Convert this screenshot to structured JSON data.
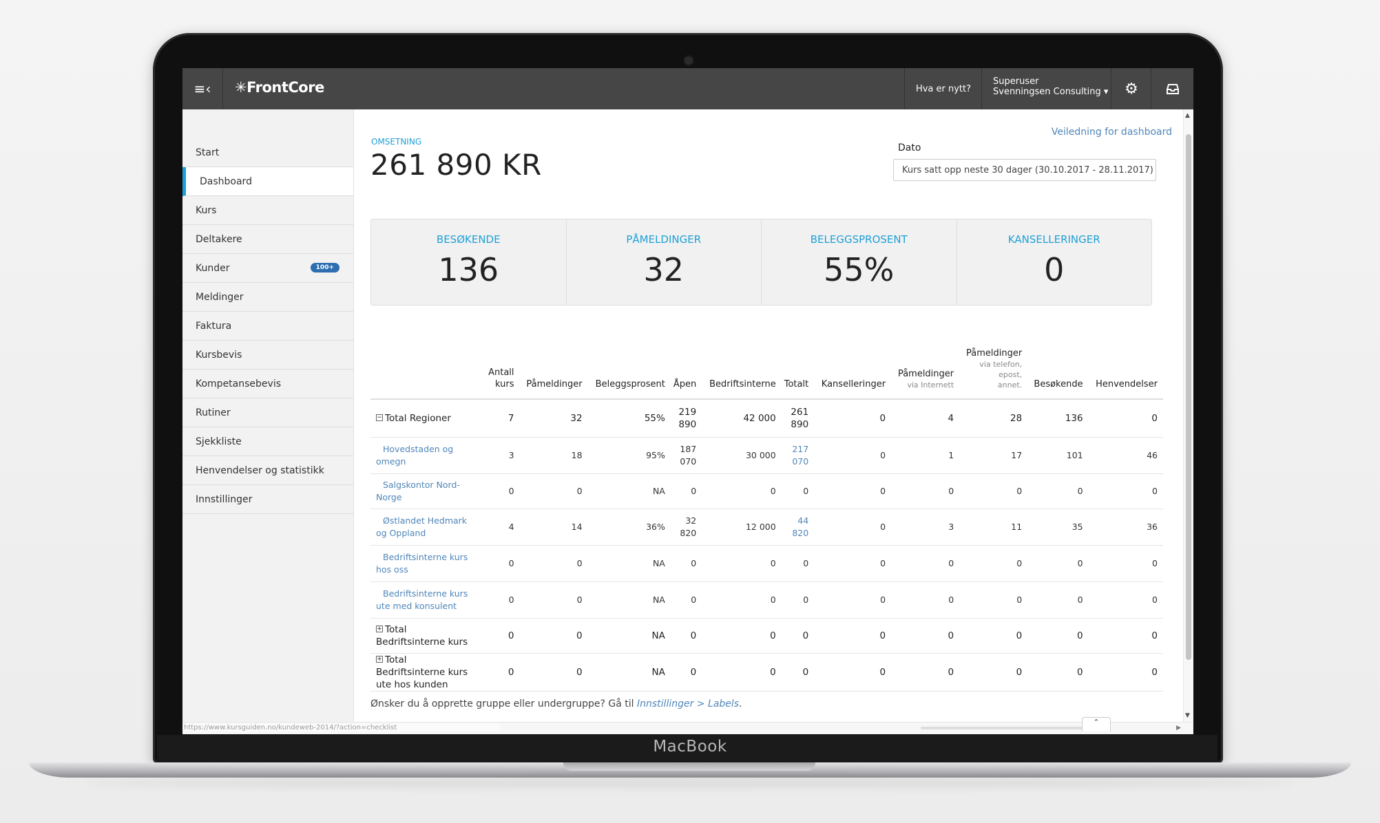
{
  "device": {
    "brand": "MacBook"
  },
  "header": {
    "logo": "✳FrontCore",
    "news_label": "Hva er nytt?",
    "user_role": "Superuser",
    "user_company": "Svenningsen Consulting",
    "menu_icon": "hamburger-collapse-icon",
    "settings_icon": "gear-icon",
    "inbox_icon": "inbox-icon"
  },
  "sidebar": {
    "items": [
      {
        "label": "Start"
      },
      {
        "label": "Dashboard",
        "active": true
      },
      {
        "label": "Kurs"
      },
      {
        "label": "Deltakere"
      },
      {
        "label": "Kunder",
        "badge": "100+"
      },
      {
        "label": "Meldinger"
      },
      {
        "label": "Faktura"
      },
      {
        "label": "Kursbevis"
      },
      {
        "label": "Kompetansebevis"
      },
      {
        "label": "Rutiner"
      },
      {
        "label": "Sjekkliste"
      },
      {
        "label": "Henvendelser og statistikk"
      },
      {
        "label": "Innstillinger"
      }
    ]
  },
  "main": {
    "omsetning_label": "OMSETNING",
    "omsetning_value": "261 890 KR",
    "guide_link": "Veiledning for dashboard",
    "date_label": "Dato",
    "date_value": "Kurs satt opp neste 30 dager (30.10.2017 - 28.11.2017)",
    "stats": [
      {
        "label": "BESØKENDE",
        "value": "136"
      },
      {
        "label": "PÅMELDINGER",
        "value": "32"
      },
      {
        "label": "BELEGGSPROSENT",
        "value": "55%"
      },
      {
        "label": "KANSELLERINGER",
        "value": "0"
      }
    ],
    "table": {
      "headers": [
        {
          "line1": "Antall",
          "line2": "kurs"
        },
        {
          "line1": "Påmeldinger"
        },
        {
          "line1": "Beleggsprosent"
        },
        {
          "line1": "Åpen"
        },
        {
          "line1": "Bedriftsinterne"
        },
        {
          "line1": "Totalt"
        },
        {
          "line1": "Kanselleringer"
        },
        {
          "line1": "Påmeldinger",
          "sub": "via Internett"
        },
        {
          "line1": "Påmeldinger",
          "sub": "via telefon, epost, annet."
        },
        {
          "line1": "Besøkende"
        },
        {
          "line1": "Henvendelser"
        }
      ],
      "rows": [
        {
          "name": "Total Regioner",
          "toggle": "⊟",
          "kind": "total",
          "cells": [
            "7",
            "32",
            "55%",
            "219 890",
            "42 000",
            "261 890",
            "0",
            "4",
            "28",
            "136",
            "0"
          ]
        },
        {
          "name": "Hovedstaden og omegn",
          "kind": "sub",
          "cells": [
            "3",
            "18",
            "95%",
            "187 070",
            "30 000",
            "217 070",
            "0",
            "1",
            "17",
            "101",
            "46"
          ]
        },
        {
          "name": "Salgskontor Nord-Norge",
          "kind": "sub",
          "cells": [
            "0",
            "0",
            "NA",
            "0",
            "0",
            "0",
            "0",
            "0",
            "0",
            "0",
            "0"
          ]
        },
        {
          "name": "Østlandet Hedmark og Oppland",
          "kind": "sub",
          "cells": [
            "4",
            "14",
            "36%",
            "32 820",
            "12 000",
            "44 820",
            "0",
            "3",
            "11",
            "35",
            "36"
          ]
        },
        {
          "name": "Bedriftsinterne kurs hos oss",
          "kind": "sub",
          "cells": [
            "0",
            "0",
            "NA",
            "0",
            "0",
            "0",
            "0",
            "0",
            "0",
            "0",
            "0"
          ]
        },
        {
          "name": "Bedriftsinterne kurs ute med konsulent",
          "kind": "sub",
          "cells": [
            "0",
            "0",
            "NA",
            "0",
            "0",
            "0",
            "0",
            "0",
            "0",
            "0",
            "0"
          ]
        },
        {
          "name": "Total Bedriftsinterne kurs",
          "toggle": "⊞",
          "kind": "total",
          "cells": [
            "0",
            "0",
            "NA",
            "0",
            "0",
            "0",
            "0",
            "0",
            "0",
            "0",
            "0"
          ]
        },
        {
          "name": "Total Bedriftsinterne kurs ute hos kunden",
          "toggle": "⊞",
          "kind": "total",
          "cells": [
            "0",
            "0",
            "NA",
            "0",
            "0",
            "0",
            "0",
            "0",
            "0",
            "0",
            "0"
          ]
        }
      ]
    },
    "footnote_text": "Ønsker du å opprette gruppe eller undergruppe? Gå til ",
    "footnote_link": "Innstillinger > Labels",
    "footnote_end": "."
  },
  "statusbar": {
    "url": "https://www.kursguiden.no/kundeweb-2014/?action=checklist"
  }
}
